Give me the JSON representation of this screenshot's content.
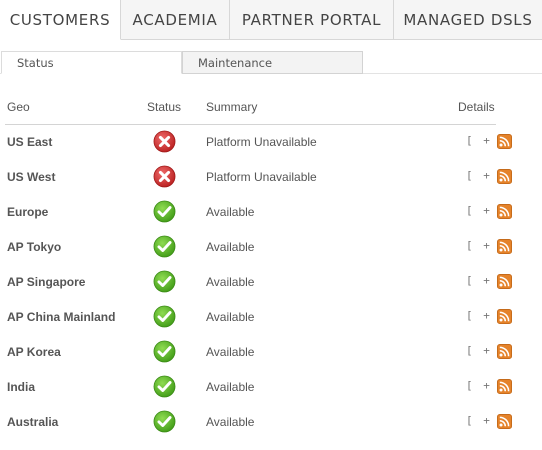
{
  "top_tabs": [
    {
      "label": "CUSTOMERS",
      "active": true
    },
    {
      "label": "ACADEMIA",
      "active": false
    },
    {
      "label": "PARTNER PORTAL",
      "active": false
    },
    {
      "label": "MANAGED DSLS",
      "active": false
    }
  ],
  "sub_tabs": [
    {
      "label": "Status",
      "active": true
    },
    {
      "label": "Maintenance",
      "active": false
    }
  ],
  "table": {
    "headers": {
      "geo": "Geo",
      "status": "Status",
      "summary": "Summary",
      "details": "Details"
    },
    "expand_label": "[ + ]",
    "rows": [
      {
        "geo": "US East",
        "status": "error",
        "summary": "Platform Unavailable"
      },
      {
        "geo": "US West",
        "status": "error",
        "summary": "Platform Unavailable"
      },
      {
        "geo": "Europe",
        "status": "ok",
        "summary": "Available"
      },
      {
        "geo": "AP Tokyo",
        "status": "ok",
        "summary": "Available"
      },
      {
        "geo": "AP Singapore",
        "status": "ok",
        "summary": "Available"
      },
      {
        "geo": "AP China Mainland",
        "status": "ok",
        "summary": "Available"
      },
      {
        "geo": "AP Korea",
        "status": "ok",
        "summary": "Available"
      },
      {
        "geo": "India",
        "status": "ok",
        "summary": "Available"
      },
      {
        "geo": "Australia",
        "status": "ok",
        "summary": "Available"
      }
    ]
  },
  "icons": {
    "ok": "check-circle-icon",
    "error": "x-circle-icon",
    "rss": "rss-feed-icon"
  },
  "colors": {
    "ok": "#5cb829",
    "error": "#cc2b2b",
    "rss": "#e5832a"
  }
}
